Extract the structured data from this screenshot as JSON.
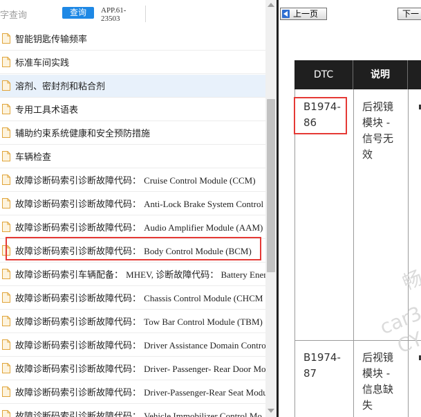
{
  "search": {
    "hint": "字查询",
    "button_label": "查询",
    "app_version_line1": "APP.61-",
    "app_version_line2": "23503"
  },
  "nav": {
    "items": [
      {
        "label": "智能钥匙传输频率",
        "en": ""
      },
      {
        "label": "标准车间实践",
        "en": ""
      },
      {
        "label": "溶剂、密封剂和粘合剂",
        "en": ""
      },
      {
        "label": "专用工具术语表",
        "en": ""
      },
      {
        "label": "辅助约束系统健康和安全预防措施",
        "en": ""
      },
      {
        "label": "车辆检查",
        "en": ""
      },
      {
        "label": "故障诊断码索引诊断故障代码：",
        "en": "Cruise Control Module (CCM)"
      },
      {
        "label": "故障诊断码索引诊断故障代码：",
        "en": "Anti-Lock Brake System Control"
      },
      {
        "label": "故障诊断码索引诊断故障代码：",
        "en": "Audio Amplifier Module (AAM)"
      },
      {
        "label": "故障诊断码索引诊断故障代码：",
        "en": "Body Control Module (BCM)"
      },
      {
        "label": "故障诊断码索引车辆配备：",
        "en": "MHEV, 诊断故障代码： Battery Energ"
      },
      {
        "label": "故障诊断码索引诊断故障代码：",
        "en": "Chassis Control Module (CHCM"
      },
      {
        "label": "故障诊断码索引诊断故障代码：",
        "en": "Tow Bar Control Module (TBM)"
      },
      {
        "label": "故障诊断码索引诊断故障代码：",
        "en": "Driver Assistance Domain Contro"
      },
      {
        "label": "故障诊断码索引诊断故障代码：",
        "en": "Driver- Passenger- Rear Door Mo"
      },
      {
        "label": "故障诊断码索引诊断故障代码：",
        "en": "Driver-Passenger-Rear Seat Modu"
      },
      {
        "label": "故障诊断码索引诊断故障代码：",
        "en": "Vehicle Immobilizer Control Mo"
      }
    ]
  },
  "viewer": {
    "prev_label": "上一页",
    "next_label": "下一"
  },
  "dtc_table": {
    "headers": {
      "dtc": "DTC",
      "desc": "说明"
    },
    "rows": [
      {
        "code_l1": "B1974-",
        "code_l2": "86",
        "desc_l1": "后视镜",
        "desc_l2": "模块 -",
        "desc_l3": "信号无",
        "desc_l4": "效"
      },
      {
        "code_l1": "B1974-",
        "code_l2": "87",
        "desc_l1": "后视镜",
        "desc_l2": "模块 -",
        "desc_l3": "信息缺",
        "desc_l4": "失"
      }
    ]
  },
  "colors": {
    "accent": "#1e88e5",
    "highlight_border": "#e53935",
    "table_header": "#1f1f1f"
  }
}
